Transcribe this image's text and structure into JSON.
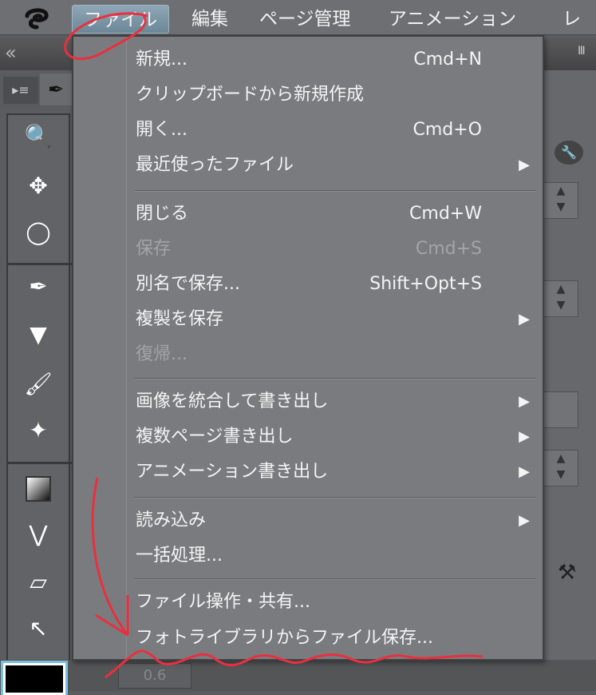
{
  "menubar": {
    "items": [
      {
        "label": "ファイル",
        "active": true
      },
      {
        "label": "編集"
      },
      {
        "label": "ページ管理"
      },
      {
        "label": "アニメーション"
      },
      {
        "label": "レイ"
      }
    ]
  },
  "file_menu": {
    "items": [
      {
        "label": "新規...",
        "shortcut": "Cmd+N"
      },
      {
        "label": "クリップボードから新規作成"
      },
      {
        "label": "開く...",
        "shortcut": "Cmd+O"
      },
      {
        "label": "最近使ったファイル",
        "submenu": true
      },
      {
        "label": "閉じる",
        "shortcut": "Cmd+W"
      },
      {
        "label": "保存",
        "shortcut": "Cmd+S",
        "disabled": true
      },
      {
        "label": "別名で保存...",
        "shortcut": "Shift+Opt+S"
      },
      {
        "label": "複製を保存",
        "submenu": true
      },
      {
        "label": "復帰...",
        "disabled": true
      },
      {
        "label": "画像を統合して書き出し",
        "submenu": true
      },
      {
        "label": "複数ページ書き出し",
        "submenu": true
      },
      {
        "label": "アニメーション書き出し",
        "submenu": true
      },
      {
        "label": "読み込み",
        "submenu": true
      },
      {
        "label": "一括処理..."
      },
      {
        "label": "ファイル操作・共有..."
      },
      {
        "label": "フォトライブラリからファイル保存..."
      }
    ]
  },
  "bottom": {
    "value": "0.6"
  },
  "icons": {
    "submenu_arrow": "▶"
  },
  "colors": {
    "annotation": "#e8303f",
    "highlight": "#7f98a8"
  }
}
